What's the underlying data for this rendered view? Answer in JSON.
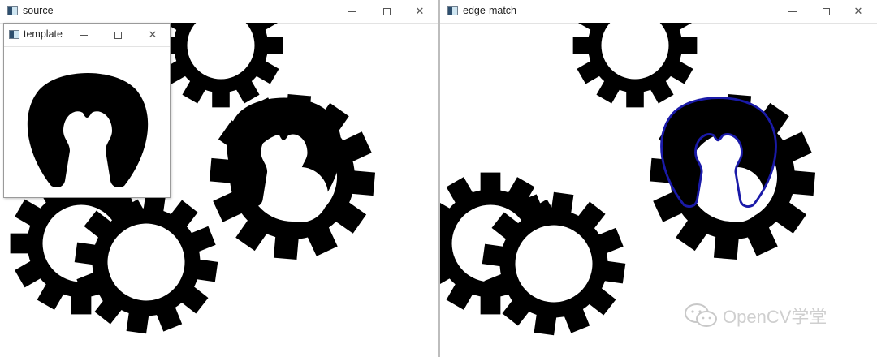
{
  "source_window": {
    "title": "source"
  },
  "template_window": {
    "title": "template"
  },
  "edge_window": {
    "title": "edge-match"
  },
  "controls": {
    "minimize": "−",
    "maximize": "□",
    "close": "✕"
  },
  "watermark": {
    "text": "OpenCV学堂"
  },
  "colors": {
    "shape": "#000000",
    "match_outline": "#1a1aa8",
    "background": "#ffffff"
  }
}
